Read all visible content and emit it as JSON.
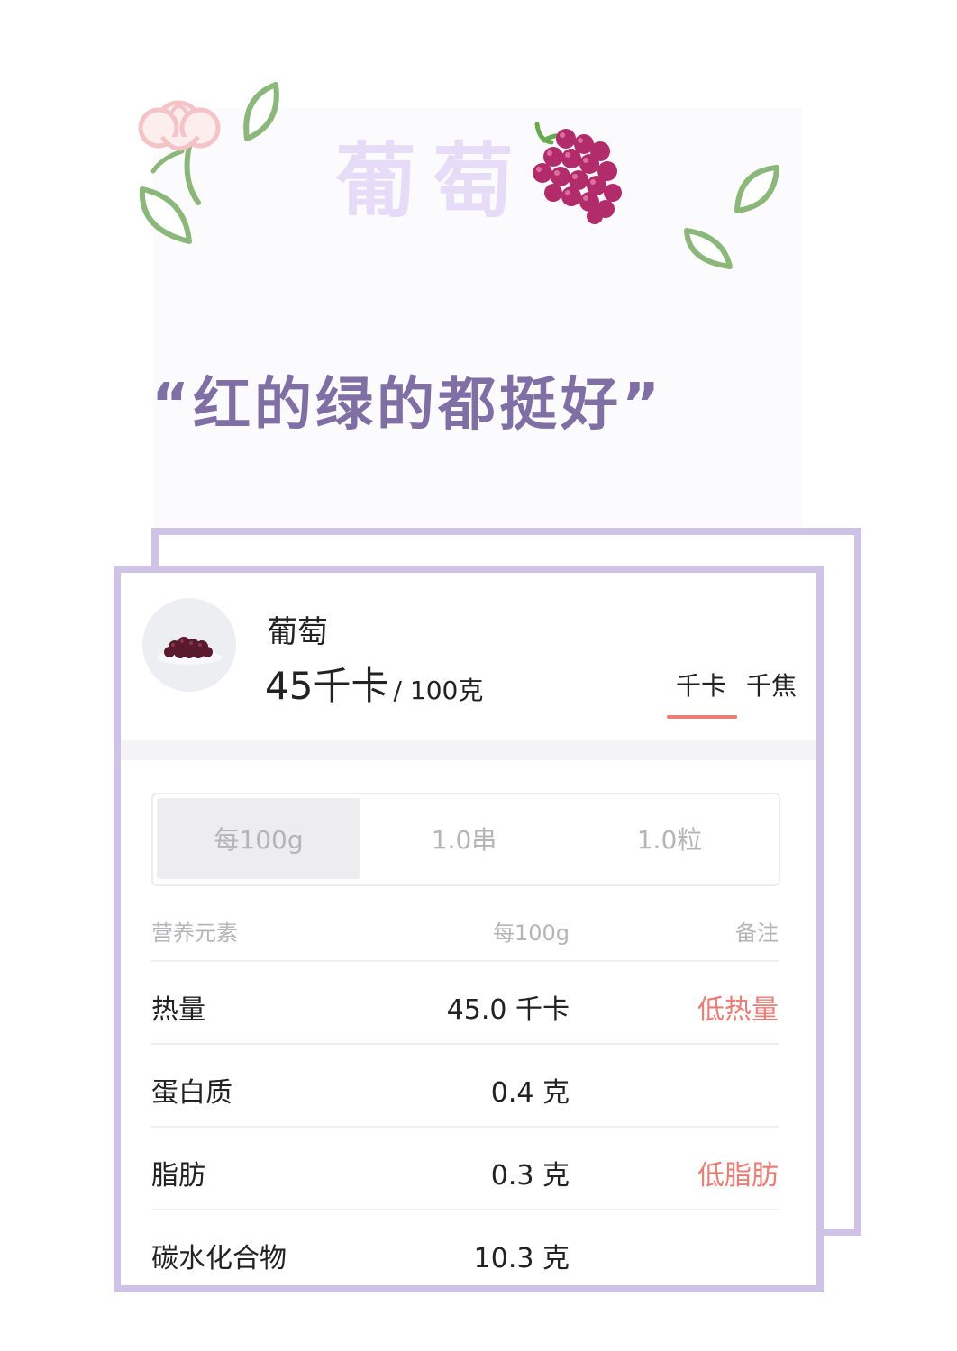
{
  "header": {
    "title": "葡萄",
    "quote": "“红的绿的都挺好”",
    "icons": [
      "flower-icon",
      "leaf-icon",
      "grape-icon"
    ]
  },
  "food": {
    "name": "葡萄",
    "calories": "45千卡",
    "per": "/ 100克",
    "unit_tabs": [
      "千卡",
      "千焦"
    ],
    "active_unit": "千卡"
  },
  "serving": {
    "options": [
      "每100g",
      "1.0串",
      "1.0粒"
    ],
    "active": "每100g"
  },
  "table": {
    "headers": [
      "营养元素",
      "每100g",
      "备注"
    ],
    "rows": [
      {
        "name": "热量",
        "value": "45.0 千卡",
        "note": "低热量"
      },
      {
        "name": "蛋白质",
        "value": "0.4 克",
        "note": ""
      },
      {
        "name": "脂肪",
        "value": "0.3 克",
        "note": "低脂肪"
      },
      {
        "name": "碳水化合物",
        "value": "10.3 克",
        "note": ""
      }
    ]
  },
  "colors": {
    "frame": "#cfc2e7",
    "title": "#e6dcf8",
    "quote": "#7f6fa5",
    "accent": "#ec7c76"
  }
}
